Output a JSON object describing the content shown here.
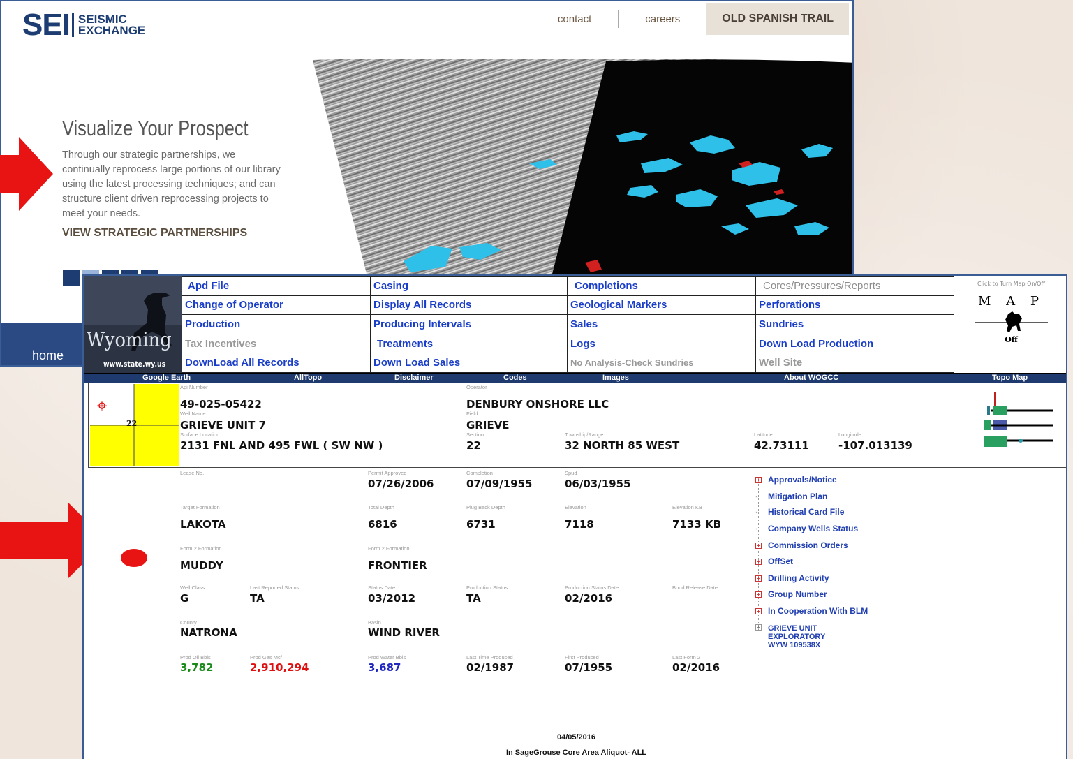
{
  "sei": {
    "logo_main": "SEI",
    "logo_line1": "SEISMIC",
    "logo_line2": "EXCHANGE",
    "nav_contact": "contact",
    "nav_careers": "careers",
    "nav_project": "OLD SPANISH TRAIL",
    "hero_title": "Visualize Your Prospect",
    "hero_body": "Through our strategic partnerships, we continually reprocess large portions of our library using the latest processing techniques; and can structure client driven reprocessing projects to meet your needs.",
    "hero_link": "VIEW STRATEGIC PARTNERSHIPS",
    "footer_home": "home"
  },
  "wogcc": {
    "logo_text": "Wyoming",
    "logo_url": "www.state.wy.us",
    "menu": [
      [
        "Apd File",
        "Casing",
        "Completions",
        "Cores/Pressures/Reports"
      ],
      [
        "Change of Operator",
        "Display All Records",
        "Geological Markers",
        "Perforations"
      ],
      [
        "Production",
        "Producing Intervals",
        "Sales",
        "Sundries"
      ],
      [
        "Tax Incentives",
        "Treatments",
        "Logs",
        "Down Load Production"
      ],
      [
        "DownLoad All Records",
        "Down Load Sales",
        "No Analysis-Check Sundries",
        "Well Site"
      ]
    ],
    "map_caption": "Click to Turn Map On/Off",
    "map_label": "M A P",
    "map_state": "Off",
    "bluebar": {
      "google_earth": "Google Earth",
      "alltopo": "AllTopo",
      "disclaimer": "Disclaimer",
      "codes": "Codes",
      "images": "Images",
      "about": "About WOGCC",
      "topo": "Topo Map"
    },
    "section_number": "22",
    "header": {
      "api_label": "Api Number",
      "api": "49-025-05422",
      "operator_label": "Operator",
      "operator": "DENBURY ONSHORE LLC",
      "wellname_label": "Well Name",
      "wellname": "GRIEVE UNIT 7",
      "field_label": "Field",
      "field": "GRIEVE",
      "surface_label": "Surface Location",
      "surface": "2131 FNL AND 495 FWL ( SW NW )",
      "section_label": "Section",
      "section": "22",
      "twp_label": "Township/Range",
      "twp": "32 NORTH 85 WEST",
      "lat_label": "Latitude",
      "lat": "42.73111",
      "lon_label": "Longitude",
      "lon": "-107.013139"
    },
    "details": {
      "lease_label": "Lease No.",
      "permit_label": "Permit Approved",
      "permit": "07/26/2006",
      "completion_label": "Completion",
      "completion": "07/09/1955",
      "spud_label": "Spud",
      "spud": "06/03/1955",
      "target_label": "Target Formation",
      "target": "LAKOTA",
      "td_label": "Total Depth",
      "td": "6816",
      "pbd_label": "Plug Back Depth",
      "pbd": "6731",
      "elev_label": "Elevation",
      "elev": "7118",
      "elevkb_label": "Elevation KB",
      "elevkb": "7133 KB",
      "f2a_label": "Form 2 Formation",
      "f2a": "MUDDY",
      "f2b_label": "Form 2 Formation",
      "f2b": "FRONTIER",
      "class_label": "Well Class",
      "class": "G",
      "lrs_label": "Last Reported Status",
      "lrs": "TA",
      "sdate_label": "Status Date",
      "sdate": "03/2012",
      "pstatus_label": "Production Status",
      "pstatus": "TA",
      "psdate_label": "Production Status Date",
      "psdate": "02/2016",
      "bond_label": "Bond Release Date",
      "county_label": "County",
      "county": "NATRONA",
      "basin_label": "Basin",
      "basin": "WIND RIVER",
      "oil_label": "Prod Oil Bbls",
      "oil": "3,782",
      "gas_label": "Prod Gas Mcf",
      "gas": "2,910,294",
      "water_label": "Prod Water Bbls",
      "water": "3,687",
      "ltp_label": "Last Time Produced",
      "ltp": "02/1987",
      "fp_label": "First Produced",
      "fp": "07/1955",
      "lf2_label": "Last Form 2",
      "lf2": "02/2016"
    },
    "side_links": [
      "Approvals/Notice",
      "Mitigation Plan",
      "Historical Card File",
      "Company Wells Status",
      "Commission Orders",
      "OffSet",
      "Drilling Activity",
      "Group Number",
      "In Cooperation With BLM"
    ],
    "unit_line1": "GRIEVE UNIT",
    "unit_line2": "EXPLORATORY",
    "unit_line3": "WYW 109538X",
    "footer_date": "04/05/2016",
    "footer_note": "In SageGrouse Core Area Aliquot- ALL"
  },
  "colors": {
    "arrow": "#e81414",
    "sei_blue": "#1c3c72",
    "link_blue": "#1a3ec8"
  }
}
